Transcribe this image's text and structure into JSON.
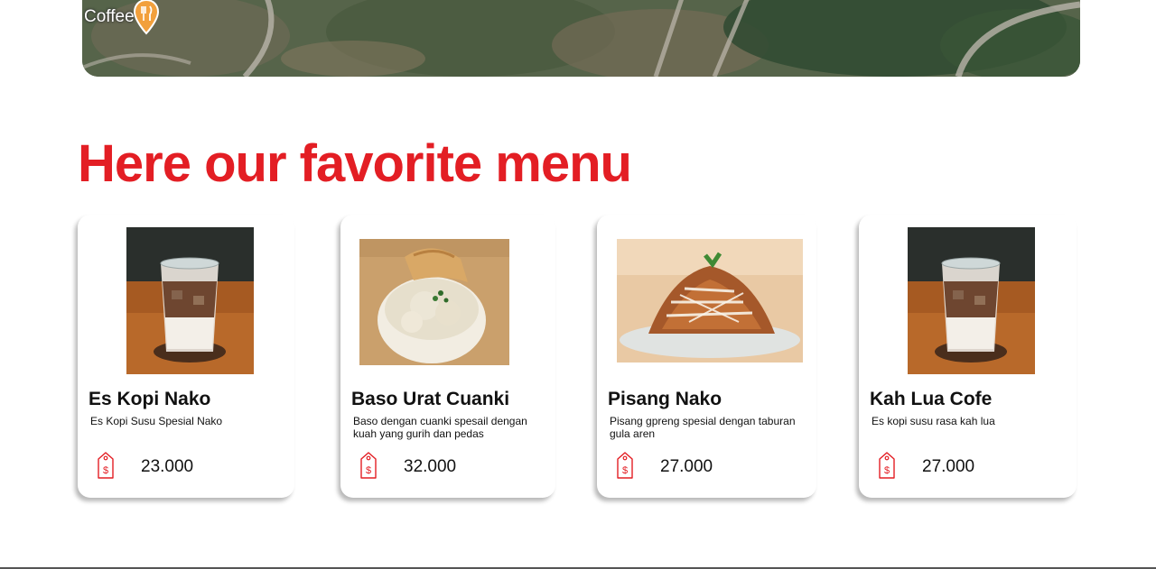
{
  "map": {
    "place_label": "Coffee",
    "place_icon": "restaurant-pin-icon"
  },
  "heading": "Here our favorite menu",
  "accent_color": "#e31e24",
  "menu": [
    {
      "name": "Es Kopi Nako",
      "description": "Es Kopi Susu Spesial Nako",
      "price": "23.000",
      "photo": "iced-coffee-photo"
    },
    {
      "name": "Baso Urat Cuanki",
      "description": "Baso dengan cuanki spesail dengan kuah yang gurih dan pedas",
      "price": "32.000",
      "photo": "meatball-soup-photo"
    },
    {
      "name": "Pisang Nako",
      "description": "Pisang gpreng spesial dengan taburan gula aren",
      "price": "27.000",
      "photo": "fried-banana-photo"
    },
    {
      "name": "Kah Lua Cofe",
      "description": "Es kopi susu rasa kah lua",
      "price": "27.000",
      "photo": "iced-coffee-photo"
    }
  ]
}
